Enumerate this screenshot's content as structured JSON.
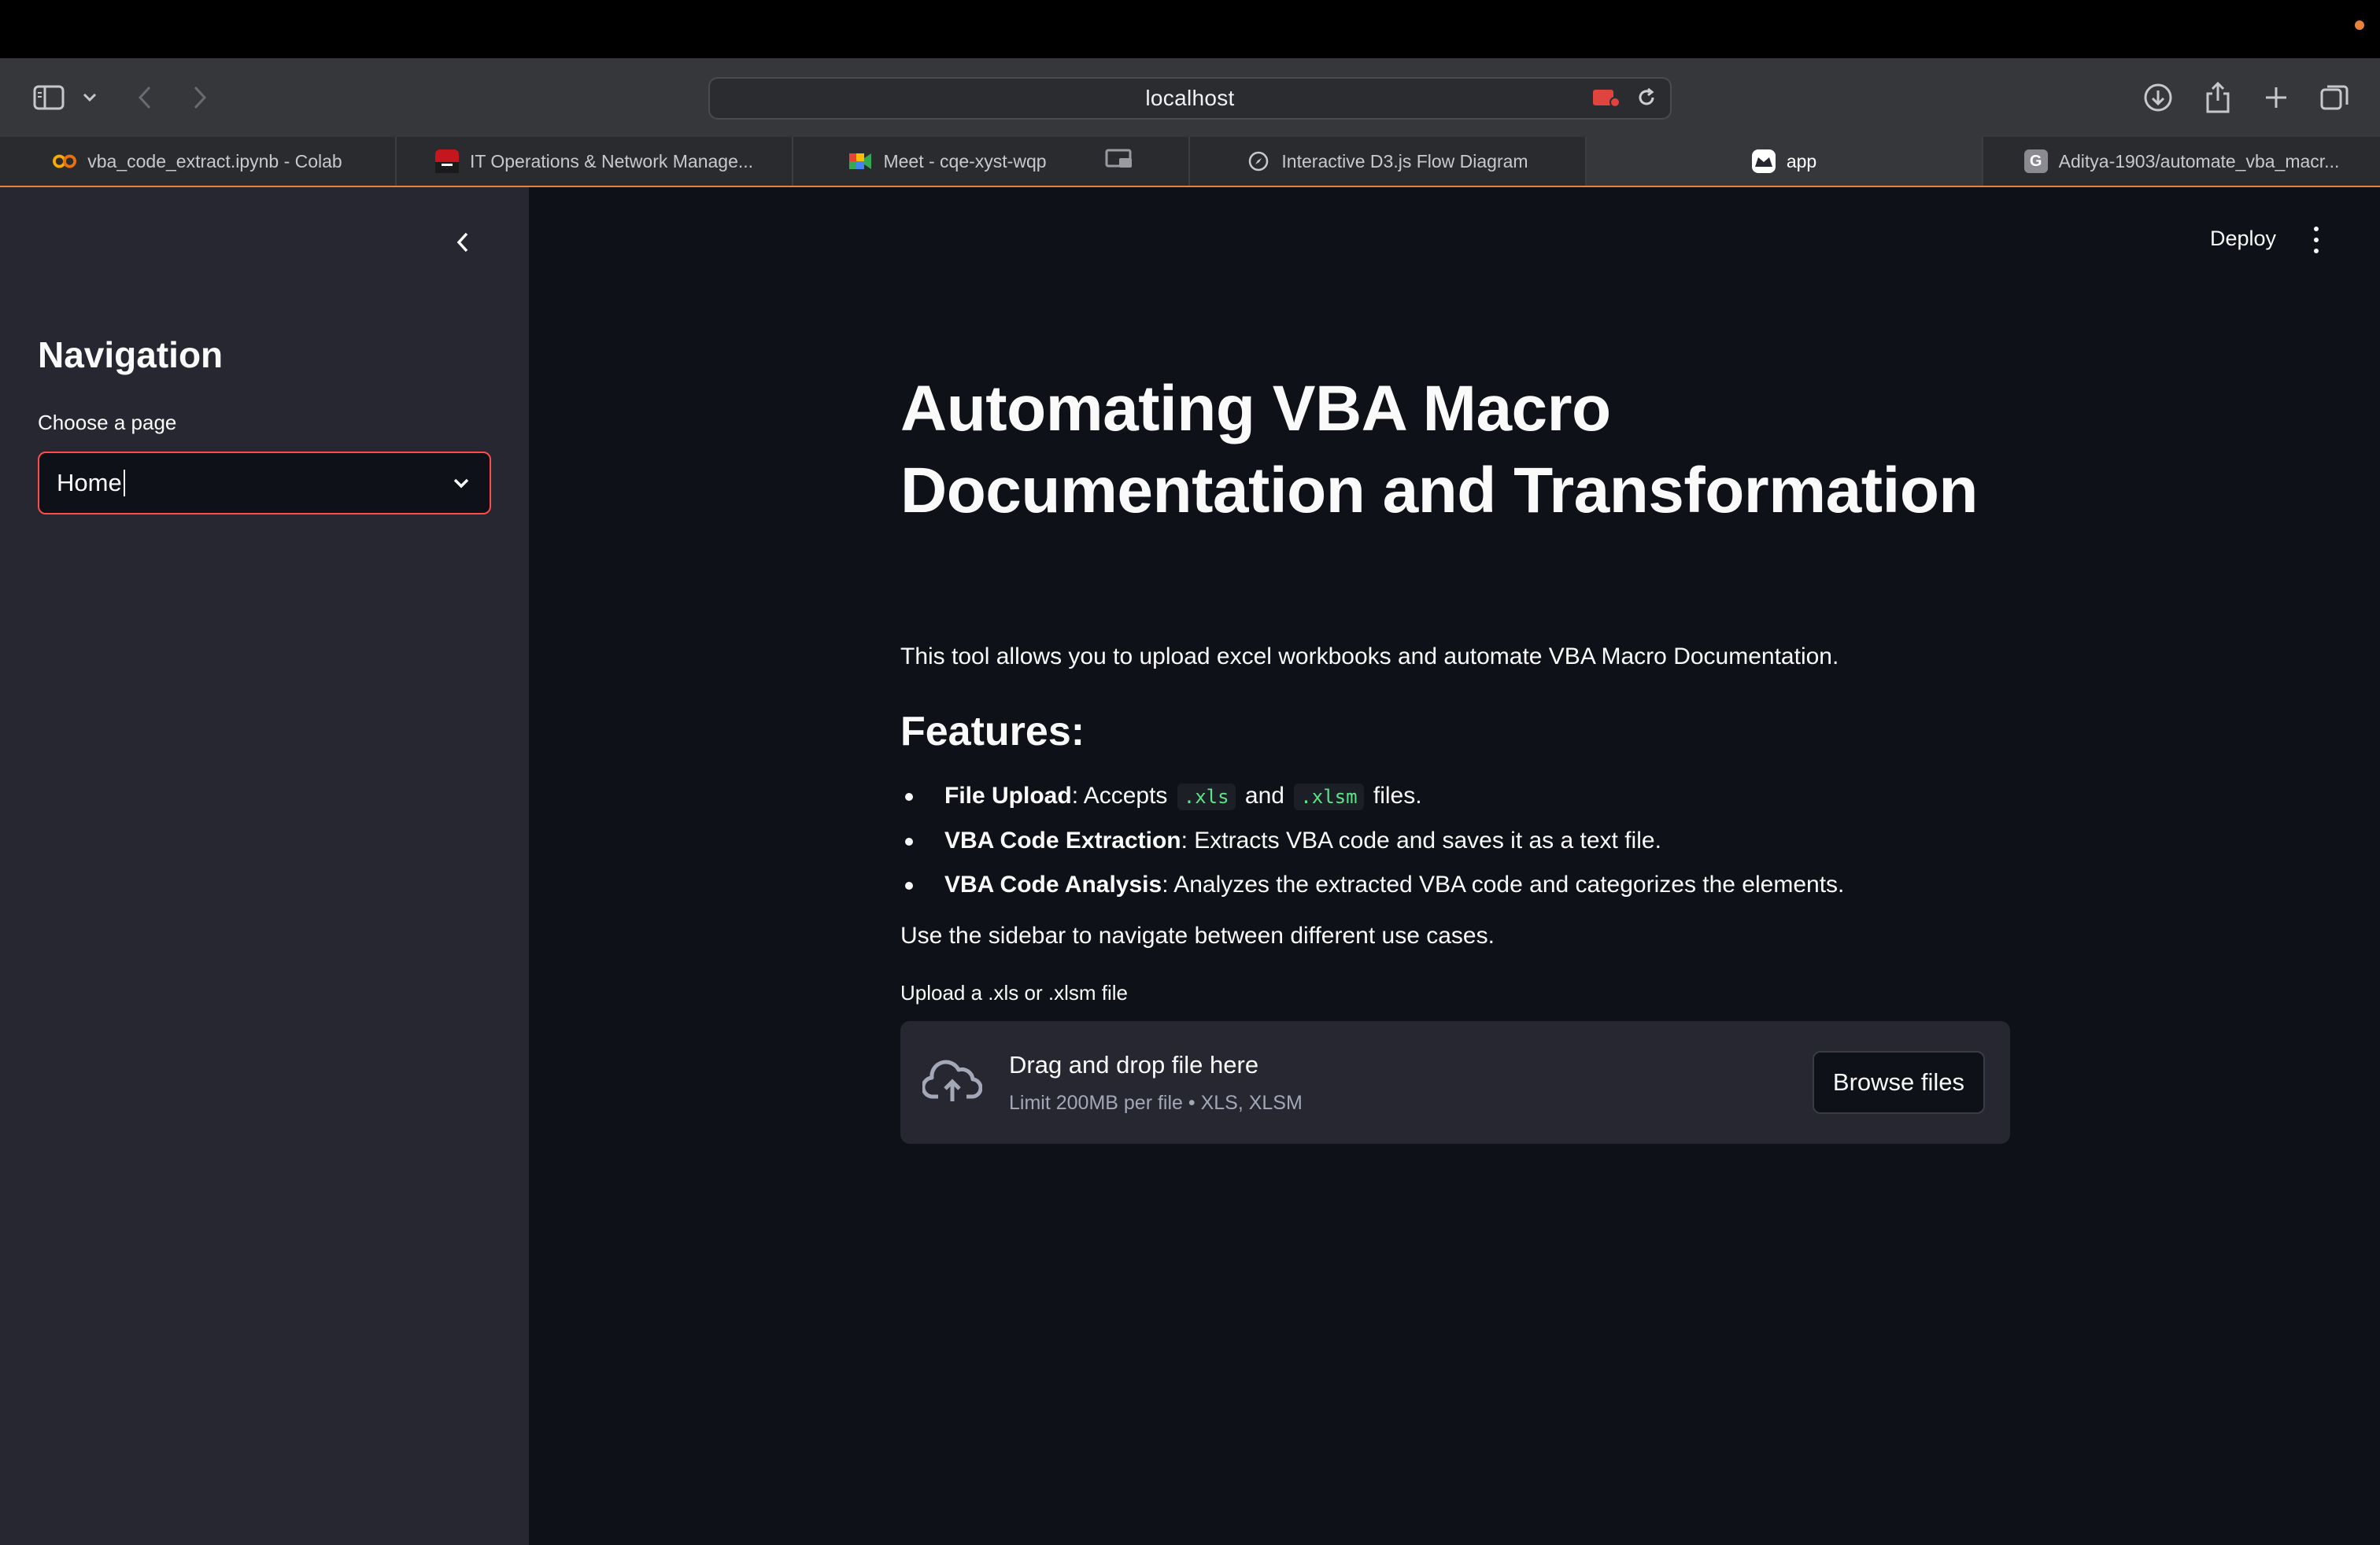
{
  "browser": {
    "url": "localhost",
    "tabs": [
      {
        "label": "vba_code_extract.ipynb - Colab",
        "icon": "colab-icon",
        "active": false
      },
      {
        "label": "IT Operations & Network Manage...",
        "icon": "site-icon",
        "active": false
      },
      {
        "label": "Meet - cqe-xyst-wqp",
        "icon": "meet-icon",
        "active": false
      },
      {
        "label": "Interactive D3.js Flow Diagram",
        "icon": "compass-icon",
        "active": false
      },
      {
        "label": "app",
        "icon": "streamlit-icon",
        "active": true
      },
      {
        "label": "Aditya-1903/automate_vba_macr...",
        "icon": "github-icon",
        "active": false
      }
    ]
  },
  "sidebar": {
    "title": "Navigation",
    "select_label": "Choose a page",
    "select_value": "Home"
  },
  "header": {
    "deploy_label": "Deploy"
  },
  "main": {
    "title": "Automating VBA Macro Documentation and Transformation",
    "intro": "This tool allows you to upload excel workbooks and automate VBA Macro Documentation.",
    "features_heading": "Features:",
    "features": [
      {
        "name": "File Upload",
        "text_before": ": Accepts ",
        "code1": ".xls",
        "mid": " and ",
        "code2": ".xlsm",
        "text_after": " files."
      },
      {
        "name": "VBA Code Extraction",
        "text": ": Extracts VBA code and saves it as a text file."
      },
      {
        "name": "VBA Code Analysis",
        "text": ": Analyzes the extracted VBA code and categorizes the elements."
      }
    ],
    "nav_hint": "Use the sidebar to navigate between different use cases.",
    "uploader": {
      "label": "Upload a .xls or .xlsm file",
      "drop_title": "Drag and drop file here",
      "drop_sub": "Limit 200MB per file • XLS, XLSM",
      "browse_label": "Browse files"
    }
  },
  "colors": {
    "accent": "#ff4b4b",
    "sidebar_bg": "#262730",
    "main_bg": "#0e1117",
    "code_green": "#5ce488",
    "tab_underline": "#e8823a"
  }
}
